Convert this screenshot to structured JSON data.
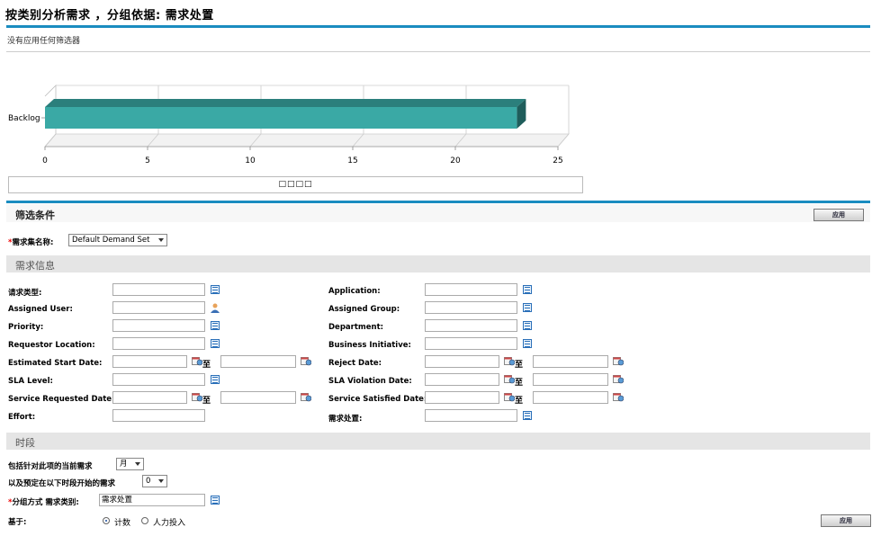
{
  "page_title": "按类别分析需求 ，分组依据: 需求处置",
  "no_filter_text": "没有应用任何筛选器",
  "chart_data": {
    "type": "bar",
    "orientation": "horizontal",
    "categories": [
      "Backlog"
    ],
    "values": [
      23
    ],
    "xlim": [
      0,
      25
    ],
    "xticks": [
      "0",
      "5",
      "10",
      "15",
      "20",
      "25"
    ],
    "legend_text": "□□□□",
    "bar_color": "#3aa9a5",
    "grid": true
  },
  "filter": {
    "title": "筛选条件",
    "apply_label": "应用",
    "demand_set_label": "需求集名称:",
    "demand_set_value": "Default Demand Set"
  },
  "demand_info": {
    "title": "需求信息",
    "fields_left": [
      {
        "label": "请求类型:",
        "icon": "list-icon"
      },
      {
        "label": "Assigned User:",
        "icon": "user-icon"
      },
      {
        "label": "Priority:",
        "icon": "list-icon"
      },
      {
        "label": "Requestor Location:",
        "icon": "list-icon"
      },
      {
        "label": "Estimated Start Date:",
        "icon": "calendar-icon",
        "range": true,
        "to": "至"
      },
      {
        "label": "SLA Level:",
        "icon": "list-icon"
      },
      {
        "label": "Service Requested Date:",
        "icon": "calendar-icon",
        "range": true,
        "to": "至"
      },
      {
        "label": "Effort:",
        "icon": ""
      }
    ],
    "fields_right": [
      {
        "label": "Application:",
        "icon": "list-icon"
      },
      {
        "label": "Assigned Group:",
        "icon": "list-icon"
      },
      {
        "label": "Department:",
        "icon": "list-icon"
      },
      {
        "label": "Business Initiative:",
        "icon": "list-icon"
      },
      {
        "label": "Reject Date:",
        "icon": "calendar-icon",
        "range": true,
        "to": "至"
      },
      {
        "label": "SLA Violation Date:",
        "icon": "calendar-icon",
        "range": true,
        "to": "至"
      },
      {
        "label": "Service Satisfied Date:",
        "icon": "calendar-icon",
        "range": true,
        "to": "至"
      },
      {
        "label": "需求处置:",
        "icon": "list-icon"
      }
    ]
  },
  "period": {
    "title": "时段",
    "current_label": "包括针对此项的当前需求",
    "current_value": "月",
    "scheduled_label": "以及预定在以下时段开始的需求",
    "scheduled_value": "0",
    "group_by_label": "分组方式 需求类别:",
    "group_by_value": "需求处置",
    "based_on_label": "基于:",
    "option_count": "计数",
    "option_effort": "人力投入",
    "apply_label": "应用"
  }
}
